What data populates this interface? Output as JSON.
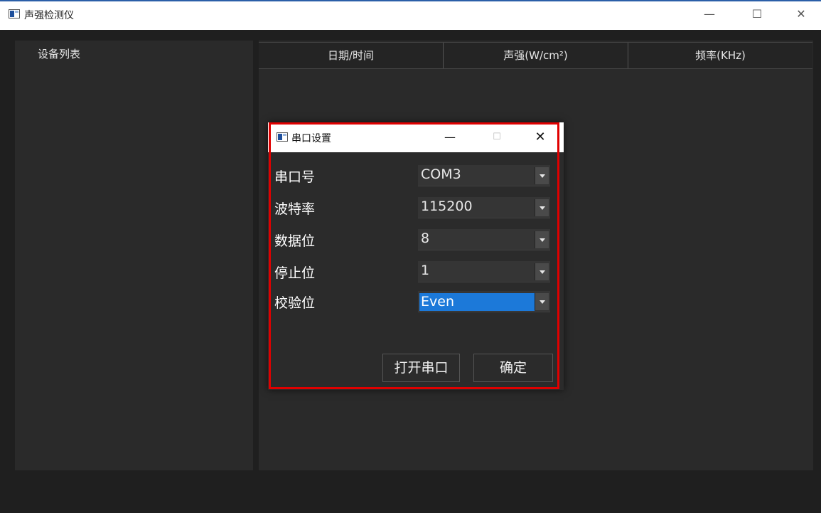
{
  "window": {
    "title": "声强检测仪",
    "minimize": "—",
    "maximize": "☐",
    "close": "✕"
  },
  "device_list": {
    "title": "设备列表"
  },
  "table": {
    "columns": [
      "日期/时间",
      "声强(W/cm²)",
      "频率(KHz)"
    ]
  },
  "dialog": {
    "title": "串口设置",
    "minimize": "—",
    "maximize": "☐",
    "close": "✕",
    "fields": [
      {
        "label": "串口号",
        "value": "COM3"
      },
      {
        "label": "波特率",
        "value": "115200"
      },
      {
        "label": "数据位",
        "value": "8"
      },
      {
        "label": "停止位",
        "value": "1"
      },
      {
        "label": "校验位",
        "value": "Even"
      }
    ],
    "buttons": {
      "open_port": "打开串口",
      "ok": "确定"
    }
  },
  "colors": {
    "highlight": "#e00000",
    "selection": "#1c79d9",
    "background": "#1f1f1f"
  }
}
